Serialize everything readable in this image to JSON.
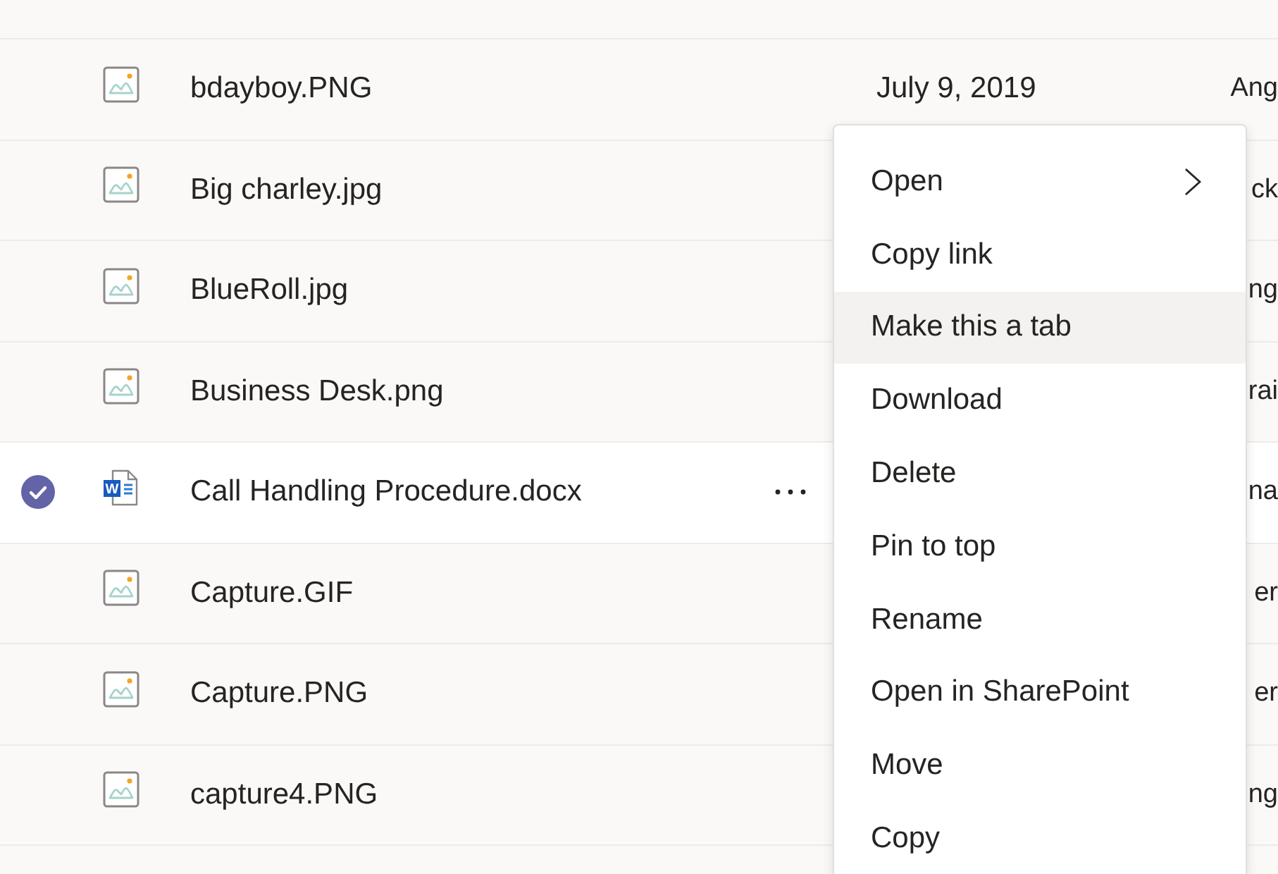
{
  "file_list": {
    "rows": [
      {
        "kind": "image",
        "name": "bdayboy.PNG",
        "date": "July 9, 2019",
        "column_5": "Ang",
        "selected": false
      },
      {
        "kind": "image",
        "name": "Big charley.jpg",
        "column_5": "ck",
        "selected": false
      },
      {
        "kind": "image",
        "name": "BlueRoll.jpg",
        "column_5": "ng",
        "selected": false
      },
      {
        "kind": "image",
        "name": "Business Desk.png",
        "column_5": "rai",
        "selected": false
      },
      {
        "kind": "word",
        "icon_letter": "W",
        "name": "Call Handling Procedure.docx",
        "column_5": "na",
        "selected": true
      },
      {
        "kind": "image",
        "name": "Capture.GIF",
        "column_5": "er",
        "selected": false
      },
      {
        "kind": "image",
        "name": "Capture.PNG",
        "column_5": "er",
        "selected": false
      },
      {
        "kind": "image",
        "name": "capture4.PNG",
        "column_5": "ng",
        "selected": false
      }
    ]
  },
  "context_menu": {
    "items": [
      {
        "label": "Open",
        "submenu": true,
        "highlighted": false
      },
      {
        "label": "Copy link",
        "submenu": false,
        "highlighted": false
      },
      {
        "label": "Make this a tab",
        "submenu": false,
        "highlighted": true
      },
      {
        "label": "Download",
        "submenu": false,
        "highlighted": false
      },
      {
        "label": "Delete",
        "submenu": false,
        "highlighted": false
      },
      {
        "label": "Pin to top",
        "submenu": false,
        "highlighted": false
      },
      {
        "label": "Rename",
        "submenu": false,
        "highlighted": false
      },
      {
        "label": "Open in SharePoint",
        "submenu": false,
        "highlighted": false
      },
      {
        "label": "Move",
        "submenu": false,
        "highlighted": false
      },
      {
        "label": "Copy",
        "submenu": false,
        "highlighted": false
      }
    ]
  }
}
